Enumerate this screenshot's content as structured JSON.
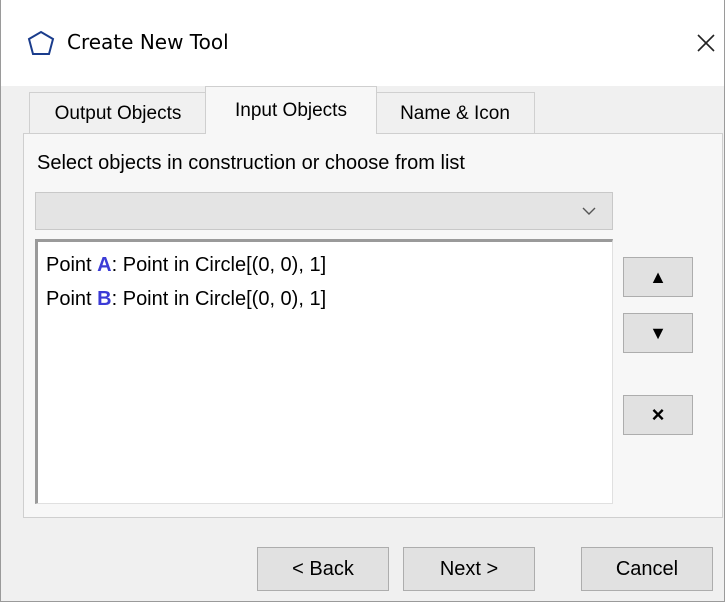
{
  "window": {
    "title": "Create New Tool",
    "close_icon": "×"
  },
  "tabs": [
    {
      "label": "Output Objects"
    },
    {
      "label": "Input Objects"
    },
    {
      "label": "Name & Icon"
    }
  ],
  "panel": {
    "instruction": "Select objects in construction or choose from list",
    "dropdown_value": "",
    "list": [
      {
        "prefix": "Point ",
        "name": "A",
        "suffix": ": Point in Circle[(0, 0), 1]"
      },
      {
        "prefix": "Point ",
        "name": "B",
        "suffix": ": Point in Circle[(0, 0), 1]"
      }
    ],
    "buttons": {
      "up": "▲",
      "down": "▼",
      "remove": "×"
    }
  },
  "footer": {
    "back": "< Back",
    "next": "Next >",
    "cancel": "Cancel"
  },
  "colors": {
    "object_name": "#3b3bd6"
  }
}
